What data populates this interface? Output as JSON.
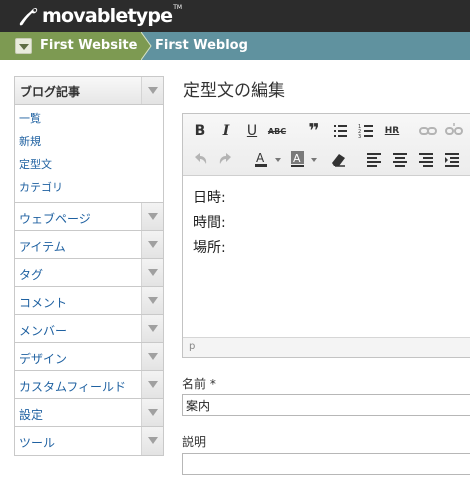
{
  "header": {
    "logo_text": "movabletype",
    "logo_tm": "TM",
    "website_label": "First Website",
    "blog_label": "First Weblog"
  },
  "sidebar": {
    "section_title": "ブログ記事",
    "subitems": [
      "一覧",
      "新規",
      "定型文",
      "カテゴリ"
    ],
    "items": [
      "ウェブページ",
      "アイテム",
      "タグ",
      "コメント",
      "メンバー",
      "デザイン",
      "カスタムフィールド",
      "設定",
      "ツール"
    ]
  },
  "main": {
    "title": "定型文の編集",
    "editor_lines": [
      "日時:",
      "時間:",
      "場所:"
    ],
    "editor_path": "p",
    "name_label": "名前 *",
    "name_value": "案内",
    "description_label": "説明",
    "description_value": ""
  },
  "toolbar": {
    "bold": "B",
    "italic": "I",
    "underline": "U",
    "strike": "ABC",
    "quote": "❞",
    "hr": "HR"
  },
  "colors": {
    "header_bg": "#2c2c2c",
    "website_bg": "#7d9a52",
    "blog_bg": "#60929f",
    "link": "#1f61a1"
  }
}
